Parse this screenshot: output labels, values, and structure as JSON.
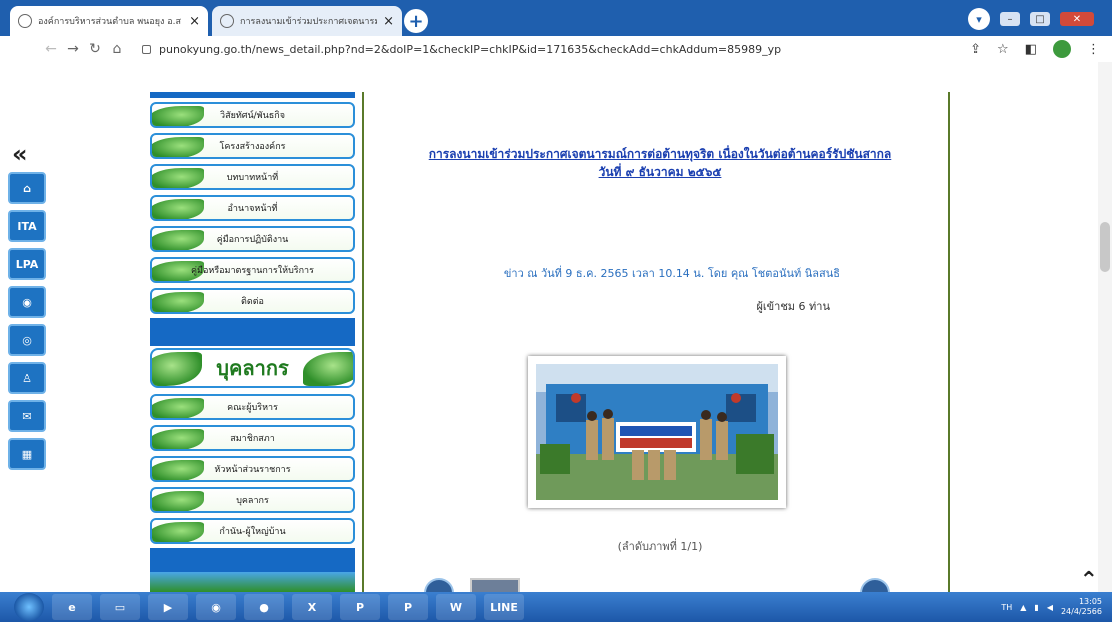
{
  "browser": {
    "tabs": [
      {
        "title": "องค์การบริหารส่วนตำบล พนอยุง อ.ส",
        "close": "×"
      },
      {
        "title": "การลงนามเข้าร่วมประกาศเจตนารมณ์",
        "close": "×"
      }
    ],
    "new_tab": "+",
    "url": "punokyung.go.th/news_detail.php?nd=2&doIP=1&checkIP=chkIP&id=171635&checkAdd=chkAddum=85989_yp"
  },
  "sidebar_icons": [
    "home-icon",
    "ITA",
    "LPA",
    "EGP",
    "EGP",
    "person-icon",
    "mail-icon",
    "sitemap-icon"
  ],
  "sidebar_icon_labels": {
    "ita": "ITA",
    "lpa": "LPA"
  },
  "menu": {
    "items_top": [
      "วิสัยทัศน์/พันธกิจ",
      "โครงสร้างองค์กร",
      "บทบาทหน้าที่",
      "อำนาจหน้าที่",
      "คู่มือการปฏิบัติงาน",
      "คู่มือหรือมาตรฐานการให้บริการ",
      "ติดต่อ"
    ],
    "heading": "บุคลากร",
    "items_bottom": [
      "คณะผู้บริหาร",
      "สมาชิกสภา",
      "หัวหน้าส่วนราชการ",
      "บุคลากร",
      "กำนัน-ผู้ใหญ่บ้าน"
    ]
  },
  "news": {
    "title_line1": "การลงนามเข้าร่วมประกาศเจตนารมณ์การต่อต้านทุจริต เนื่องในวันต่อต้านคอร์รัปชันสากล",
    "title_line2": "วันที่ ๙ ธันวาคม ๒๕๖๕",
    "meta": "ข่าว ณ  วันที่ 9 ธ.ค. 2565 เวลา 10.14 น. โดย คุณ โชตอนันท์ นิลสนธิ",
    "views": "ผู้เข้าชม 6 ท่าน",
    "caption": "(ลำดับภาพที่ 1/1)"
  },
  "taskbar": {
    "items": [
      "e",
      "",
      "",
      "",
      "",
      "X",
      "P",
      "P",
      "W",
      "LINE"
    ],
    "lang": "TH",
    "time": "13:05",
    "date": "24/4/2566"
  }
}
